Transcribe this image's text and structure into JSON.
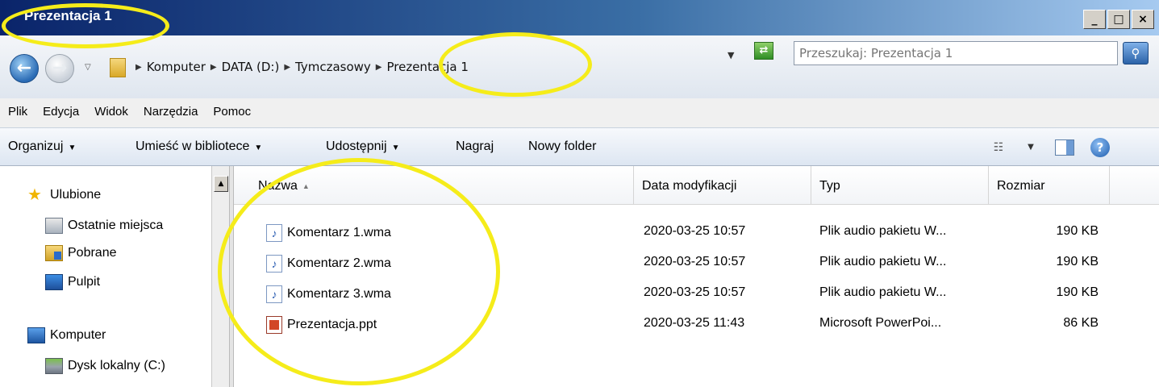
{
  "window": {
    "title": "Prezentacja 1",
    "controls": [
      "_",
      "□",
      "×"
    ]
  },
  "address": {
    "breadcrumbs": [
      "Komputer",
      "DATA (D:)",
      "Tymczasowy",
      "Prezentacja 1"
    ],
    "search_placeholder": "Przeszukaj: Prezentacja 1"
  },
  "menu": [
    "Plik",
    "Edycja",
    "Widok",
    "Narzędzia",
    "Pomoc"
  ],
  "commands": {
    "organize": "Organizuj",
    "library": "Umieść w bibliotece",
    "share": "Udostępnij",
    "burn": "Nagraj",
    "new_folder": "Nowy folder"
  },
  "nav": {
    "favorites": "Ulubione",
    "recent": "Ostatnie miejsca",
    "downloads": "Pobrane",
    "desktop": "Pulpit",
    "computer": "Komputer",
    "local_disk": "Dysk lokalny (C:)"
  },
  "columns": {
    "name": "Nazwa",
    "modified": "Data modyfikacji",
    "type": "Typ",
    "size": "Rozmiar"
  },
  "files": [
    {
      "name": "Komentarz 1.wma",
      "modified": "2020-03-25 10:57",
      "type": "Plik audio pakietu W...",
      "size": "190 KB",
      "icon": "wma-audio-icon"
    },
    {
      "name": "Komentarz 2.wma",
      "modified": "2020-03-25 10:57",
      "type": "Plik audio pakietu W...",
      "size": "190 KB",
      "icon": "wma-audio-icon"
    },
    {
      "name": "Komentarz 3.wma",
      "modified": "2020-03-25 10:57",
      "type": "Plik audio pakietu W...",
      "size": "190 KB",
      "icon": "wma-audio-icon"
    },
    {
      "name": "Prezentacja.ppt",
      "modified": "2020-03-25 11:43",
      "type": "Microsoft PowerPoi...",
      "size": "86 KB",
      "icon": "ppt-file-icon"
    }
  ],
  "colors": {
    "highlight": "#f5ec1a",
    "titlebar": "#0a246a"
  }
}
